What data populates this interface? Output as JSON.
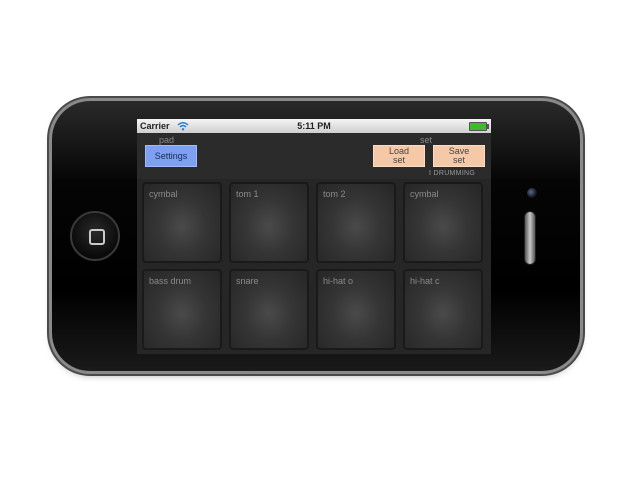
{
  "status_bar": {
    "carrier": "Carrier",
    "time": "5:11 PM",
    "wifi_icon": "wifi-icon",
    "battery_icon": "battery-icon"
  },
  "toolbar": {
    "pad_caption": "pad",
    "set_caption": "set",
    "settings_label": "Settings",
    "load_label": "Load set",
    "save_label": "Save set",
    "set_name": "I DRUMMING"
  },
  "pads": [
    {
      "label": "cymbal"
    },
    {
      "label": "tom 1"
    },
    {
      "label": "tom 2"
    },
    {
      "label": "cymbal"
    },
    {
      "label": "bass drum"
    },
    {
      "label": "snare"
    },
    {
      "label": "hi-hat o"
    },
    {
      "label": "hi-hat c"
    }
  ],
  "colors": {
    "settings_button": "#7da1f0",
    "set_buttons": "#f5c9a8",
    "pad_background": "#353535",
    "app_background": "#262626"
  }
}
